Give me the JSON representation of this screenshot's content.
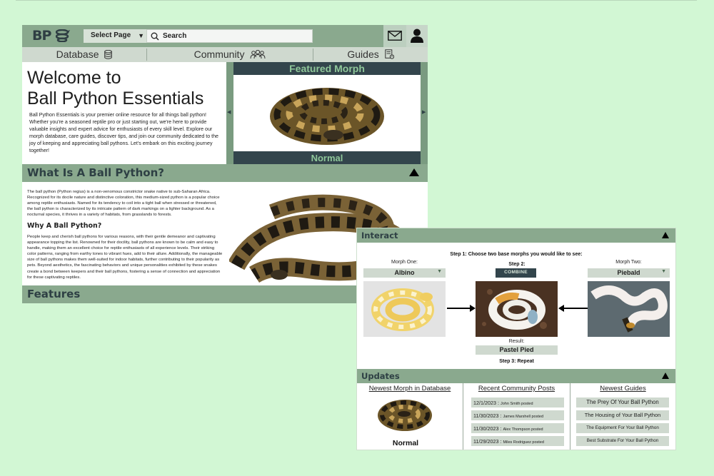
{
  "header": {
    "logo_text": "BP",
    "select_page_label": "Select Page",
    "search_placeholder": "Search",
    "icons": [
      "snake-logo-icon",
      "mail-icon",
      "user-icon",
      "search-icon",
      "caret-down-icon"
    ]
  },
  "nav": {
    "items": [
      {
        "label": "Database",
        "icon": "database-icon"
      },
      {
        "label": "Community",
        "icon": "people-icon"
      },
      {
        "label": "Guides",
        "icon": "guide-book-icon"
      }
    ]
  },
  "welcome": {
    "title_line1": "Welcome to",
    "title_line2": "Ball Python Essentials",
    "body": "Ball Python Essentials is your premier online resource for all things ball python! Whether you're a seasoned reptile pro or just starting out, we're here to provide valuable insights and expert advice for enthusiasts of every skill level. Explore our morph database, care guides, discover tips, and join our community dedicated to the joy of keeping and appreciating ball pythons. Let's embark on this exciting journey together!"
  },
  "featured": {
    "heading": "Featured Morph",
    "morph_name": "Normal",
    "prev_glyph": "◀",
    "next_glyph": "▶"
  },
  "about": {
    "heading": "What Is A Ball Python?",
    "body": "The ball python (Python regius) is a non-venomous constrictor snake native to sub-Saharan Africa. Recognized for its docile nature and distinctive coloration, this medium-sized python is a popular choice among reptile enthusiasts. Named for its tendency to coil into a tight ball when stressed or threatened, the ball python is characterized by its intricate pattern of dark markings on a lighter background. As a nocturnal species, it thrives in a variety of habitats, from grasslands to forests.",
    "why_heading": "Why A Ball Python?",
    "why_body": "People keep and cherish ball pythons for various reasons, with their gentle demeanor and captivating appearance topping the list. Renowned for their docility, ball pythons are known to be calm and easy to handle, making them an excellent choice for reptile enthusiasts of all experience levels. Their striking color patterns, ranging from earthy tones to vibrant hues, add to their allure. Additionally, the manageable size of ball pythons makes them well-suited for indoor habitats, further contributing to their popularity as pets. Beyond aesthetics, the fascinating behaviors and unique personalities exhibited by these snakes create a bond between keepers and their ball pythons, fostering a sense of connection and appreciation for these captivating reptiles."
  },
  "features": {
    "heading": "Features"
  },
  "interact": {
    "heading": "Interact",
    "step1": "Step 1: Choose two base morphs you would like to see:",
    "morph_one_label": "Morph One:",
    "morph_one_value": "Albino",
    "step2": "Step 2:",
    "combine_label": "COMBINE",
    "morph_two_label": "Morph Two:",
    "morph_two_value": "Piebald",
    "result_label": "Result:",
    "result_value": "Pastel Pied",
    "step3": "Step 3: Repeat"
  },
  "updates": {
    "heading": "Updates",
    "newest_morph_heading": "Newest Morph in Database",
    "newest_morph_name": "Normal",
    "posts_heading": "Recent Community Posts",
    "posts": [
      {
        "date": "12/1/2023",
        "author": "John Smith posted"
      },
      {
        "date": "11/30/2023",
        "author": "James Marshell posted"
      },
      {
        "date": "11/30/2023",
        "author": "Alex Thompson posted"
      },
      {
        "date": "11/29/2023",
        "author": "Miles Rodriguez posted"
      }
    ],
    "guides_heading": "Newest Guides",
    "guides": [
      "The Prey Of Your Ball Python",
      "The Housing of Your Ball Python",
      "The Equipment For Your Ball Python",
      "Best Substrate For Your Ball Python"
    ]
  },
  "colors": {
    "background": "#d2f7d4",
    "bar_green": "#8aa98e",
    "dark_slate": "#33454c",
    "light_green_accent": "#8fc79a",
    "pill_gray": "#cfd9cf"
  }
}
